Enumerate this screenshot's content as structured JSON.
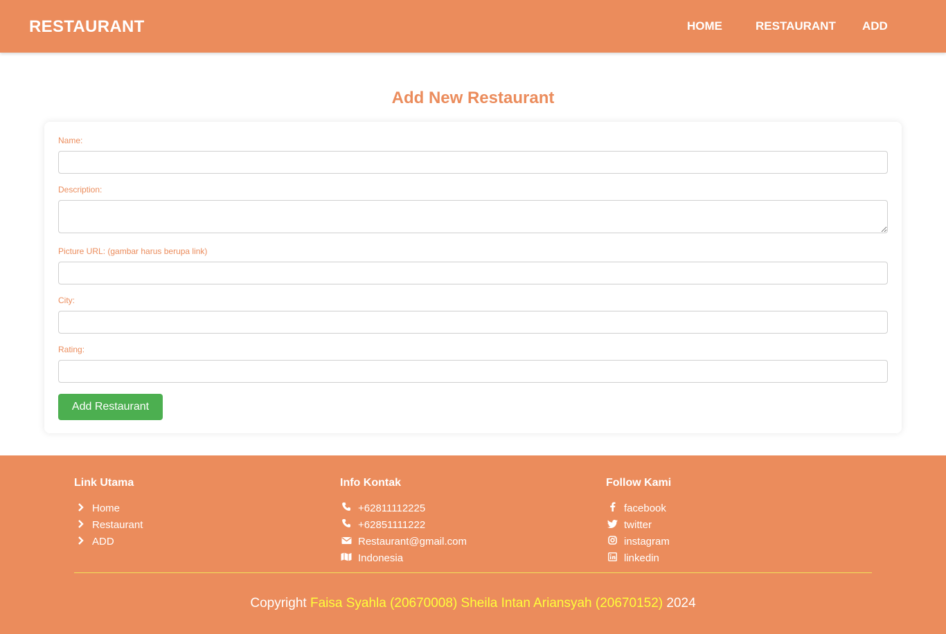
{
  "navbar": {
    "brand": "RESTAURANT",
    "links": [
      {
        "label": "HOME"
      },
      {
        "label": "RESTAURANT"
      },
      {
        "label": "ADD"
      }
    ]
  },
  "page": {
    "title": "Add New Restaurant"
  },
  "form": {
    "fields": [
      {
        "label": "Name:",
        "value": ""
      },
      {
        "label": "Description:",
        "value": ""
      },
      {
        "label": "Picture URL: (gambar harus berupa link)",
        "value": ""
      },
      {
        "label": "City:",
        "value": ""
      },
      {
        "label": "Rating:",
        "value": ""
      }
    ],
    "submit_label": "Add Restaurant"
  },
  "footer": {
    "links_title": "Link Utama",
    "links": [
      {
        "icon": "chevron-right-icon",
        "label": "Home"
      },
      {
        "icon": "chevron-right-icon",
        "label": "Restaurant"
      },
      {
        "icon": "chevron-right-icon",
        "label": "ADD"
      }
    ],
    "contact_title": "Info Kontak",
    "contacts": [
      {
        "icon": "phone-icon",
        "label": "+62811112225"
      },
      {
        "icon": "phone-icon",
        "label": "+62851111222"
      },
      {
        "icon": "envelope-icon",
        "label": "Restaurant@gmail.com"
      },
      {
        "icon": "map-icon",
        "label": "Indonesia"
      }
    ],
    "social_title": "Follow Kami",
    "socials": [
      {
        "icon": "facebook-icon",
        "label": "facebook"
      },
      {
        "icon": "twitter-icon",
        "label": "twitter"
      },
      {
        "icon": "instagram-icon",
        "label": "instagram"
      },
      {
        "icon": "linkedin-icon",
        "label": "linkedin"
      }
    ],
    "copyright": {
      "prefix": "Copyright ",
      "authors": "Faisa Syahla (20670008) Sheila Intan Ariansyah (20670152)",
      "year": " 2024"
    }
  },
  "colors": {
    "primary": "#eb8c5c",
    "button": "#4caf50",
    "highlight": "#ffff3a",
    "divider": "#f0e25a"
  }
}
